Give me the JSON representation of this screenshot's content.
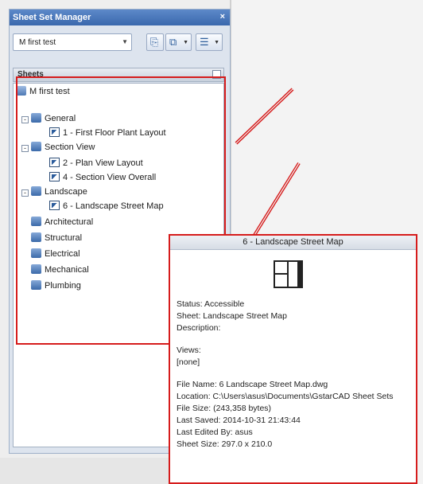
{
  "palette": {
    "title": "Sheet Set Manager",
    "close_glyph": "×",
    "sheet_set_select": {
      "value": "M first test"
    },
    "toolbar": [
      {
        "name": "new-sheet-icon",
        "glyph": "⎘"
      },
      {
        "name": "sheet-view-icon",
        "glyph": "⧉"
      },
      {
        "name": "sheet-options-icon",
        "glyph": "☰"
      }
    ],
    "section_header": "Sheets",
    "tree": {
      "root": "M first test",
      "groups": [
        {
          "label": "General",
          "sheets": [
            "1 - First Floor Plant Layout"
          ]
        },
        {
          "label": "Section View",
          "sheets": [
            "2 - Plan View Layout",
            "4 - Section View Overall"
          ]
        },
        {
          "label": "Landscape",
          "sheets": [
            "6 - Landscape Street Map"
          ]
        },
        {
          "label": "Architectural",
          "sheets": []
        },
        {
          "label": "Structural",
          "sheets": []
        },
        {
          "label": "Electrical",
          "sheets": []
        },
        {
          "label": "Mechanical",
          "sheets": []
        },
        {
          "label": "Plumbing",
          "sheets": []
        }
      ]
    }
  },
  "popup": {
    "title": "6 - Landscape Street Map",
    "status": "Status: Accessible",
    "sheet": "Sheet: Landscape Street Map",
    "description": "Description:",
    "views_label": "Views:",
    "views_value": "[none]",
    "file_name": "File Name: 6 Landscape Street Map.dwg",
    "location": "Location: C:\\Users\\asus\\Documents\\GstarCAD Sheet Sets",
    "file_size": "File Size: (243,358 bytes)",
    "last_saved": "Last Saved: 2014-10-31 21:43:44",
    "last_edited_by": "Last Edited By: asus",
    "sheet_size": "Sheet Size: 297.0 x 210.0"
  },
  "colors": {
    "annotation_red": "#d61c1c",
    "title_bar_blue": "#3a68ad"
  }
}
